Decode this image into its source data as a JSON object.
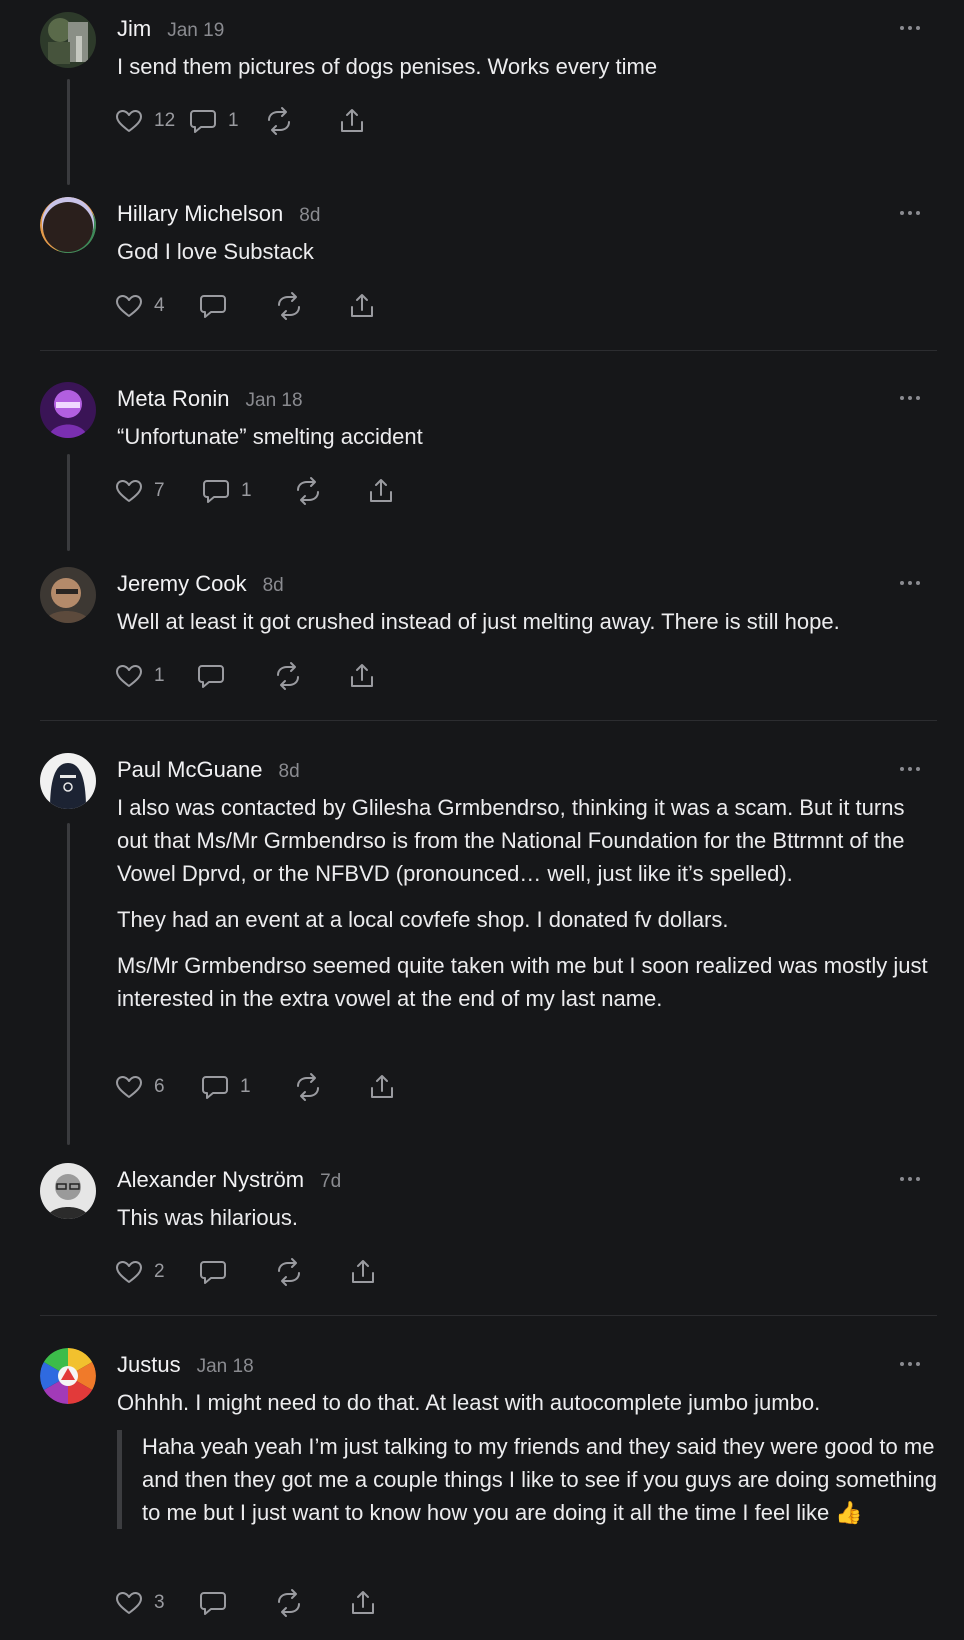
{
  "comments": [
    {
      "author": "Jim",
      "date": "Jan 19",
      "paragraphs": [
        "I send them pictures of dogs penises. Works every time"
      ],
      "likes": "12",
      "replies": "1"
    },
    {
      "author": "Hillary Michelson",
      "date": "8d",
      "paragraphs": [
        "God I love Substack"
      ],
      "likes": "4",
      "replies": ""
    },
    {
      "author": "Meta Ronin",
      "date": "Jan 18",
      "paragraphs": [
        "“Unfortunate” smelting accident"
      ],
      "likes": "7",
      "replies": "1"
    },
    {
      "author": "Jeremy Cook",
      "date": "8d",
      "paragraphs": [
        "Well at least it got crushed instead of just melting away. There is still hope."
      ],
      "likes": "1",
      "replies": ""
    },
    {
      "author": "Paul McGuane",
      "date": "8d",
      "paragraphs": [
        "I also was contacted by Glilesha Grmbendrso, thinking it was a scam. But it turns out that Ms/Mr Grmbendrso is from the National Foundation for the Bttrmnt of the Vowel Dprvd, or the NFBVD (pronounced… well, just like it’s spelled).",
        "They had an event at a local covfefe shop. I donated fv dollars.",
        "Ms/Mr Grmbendrso seemed quite taken with me but I soon realized was mostly just interested in the extra vowel at the end of my last name."
      ],
      "likes": "6",
      "replies": "1"
    },
    {
      "author": "Alexander Nyström",
      "date": "7d",
      "paragraphs": [
        "This was hilarious."
      ],
      "likes": "2",
      "replies": ""
    },
    {
      "author": "Justus",
      "date": "Jan 18",
      "paragraphs": [
        "Ohhhh. I might need to do that. At least with autocomplete jumbo jumbo."
      ],
      "quote": "Haha yeah yeah I’m just talking to my friends and they said they were good to me and then they got me a couple things I like to see if you guys are doing something to me but I just want to know how you are doing it all the time I feel like 👍",
      "likes": "3",
      "replies": ""
    }
  ],
  "icons": {
    "like": "heart-icon",
    "reply": "speech-bubble-icon",
    "restack": "restack-icon",
    "share": "share-icon",
    "more": "ellipsis-icon"
  },
  "colors": {
    "background": "#161719",
    "text": "#e9e9eb",
    "muted": "#8a8b90",
    "divider": "#2c2d30"
  }
}
